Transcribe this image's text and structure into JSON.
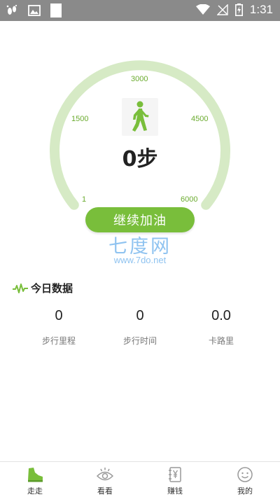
{
  "status_bar": {
    "time": "1:31"
  },
  "gauge": {
    "ticks": [
      "1",
      "1500",
      "3000",
      "4500",
      "6000"
    ],
    "steps_value": "0",
    "steps_unit": "步",
    "button_label": "继续加油"
  },
  "watermark": {
    "title": "七度网",
    "url": "www.7do.net"
  },
  "today": {
    "title": "今日数据",
    "stats": [
      {
        "value": "0",
        "label": "步行里程"
      },
      {
        "value": "0",
        "label": "步行时间"
      },
      {
        "value": "0.0",
        "label": "卡路里"
      }
    ]
  },
  "tabs": [
    {
      "label": "走走",
      "icon": "shoe-icon",
      "active": true
    },
    {
      "label": "看看",
      "icon": "eye-icon",
      "active": false
    },
    {
      "label": "赚钱",
      "icon": "yuan-note-icon",
      "active": false
    },
    {
      "label": "我的",
      "icon": "smiley-icon",
      "active": false
    }
  ],
  "colors": {
    "accent": "#79be3b",
    "arc": "#d6eac5",
    "status_bar": "#8a8a8a",
    "watermark": "#8fc3f0"
  }
}
